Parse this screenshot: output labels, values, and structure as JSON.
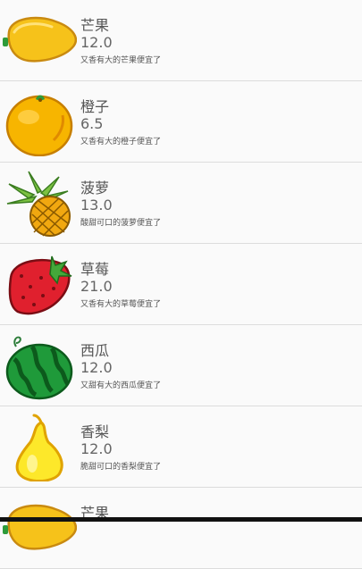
{
  "items": [
    {
      "name": "芒果",
      "price": "12.0",
      "desc": "又香有大的芒果便宜了",
      "icon": "mango-icon"
    },
    {
      "name": "橙子",
      "price": "6.5",
      "desc": "又香有大的橙子便宜了",
      "icon": "orange-icon"
    },
    {
      "name": "菠萝",
      "price": "13.0",
      "desc": "酸甜可口的菠萝便宜了",
      "icon": "pineapple-icon"
    },
    {
      "name": "草莓",
      "price": "21.0",
      "desc": "又香有大的草莓便宜了",
      "icon": "strawberry-icon"
    },
    {
      "name": "西瓜",
      "price": "12.0",
      "desc": "又甜有大的西瓜便宜了",
      "icon": "watermelon-icon"
    },
    {
      "name": "香梨",
      "price": "12.0",
      "desc": "脆甜可口的香梨便宜了",
      "icon": "pear-icon"
    },
    {
      "name": "芒果",
      "icon": "mango-icon"
    }
  ],
  "colors": {
    "background": "#fafafa",
    "divider": "#dcdcdc",
    "text": "#555555"
  }
}
